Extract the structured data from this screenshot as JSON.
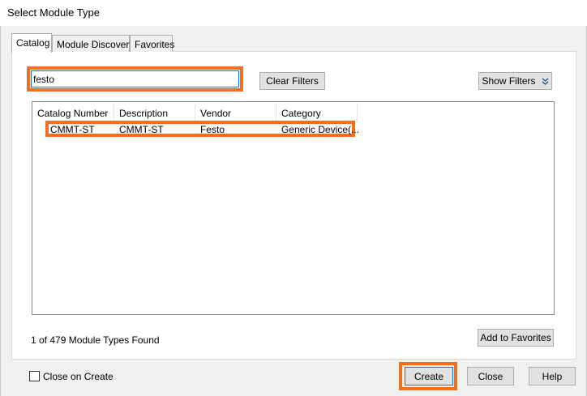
{
  "window": {
    "title": "Select Module Type"
  },
  "tabs": [
    {
      "label": "Catalog",
      "active": true
    },
    {
      "label": "Module Discovery",
      "active": false
    },
    {
      "label": "Favorites",
      "active": false
    }
  ],
  "search": {
    "value": "festo"
  },
  "buttons": {
    "clear_filters": "Clear Filters",
    "show_filters": "Show Filters",
    "add_to_favorites": "Add to Favorites",
    "create": "Create",
    "close": "Close",
    "help": "Help"
  },
  "table": {
    "columns": [
      "Catalog Number",
      "Description",
      "Vendor",
      "Category"
    ],
    "rows": [
      [
        "CMMT-ST",
        "CMMT-ST",
        "Festo",
        "Generic Device(..."
      ]
    ]
  },
  "status": {
    "found": "1 of 479 Module Types Found"
  },
  "options": {
    "close_on_create": "Close on Create",
    "close_on_create_checked": false
  },
  "colors": {
    "highlight": "#f07020",
    "focus": "#0078d7"
  }
}
